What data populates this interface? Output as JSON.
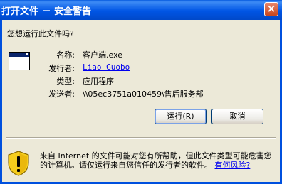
{
  "window": {
    "title": "打开文件 － 安全警告",
    "close_glyph": "×"
  },
  "dialog": {
    "question": "您想运行此文件吗?",
    "fields": [
      {
        "label": "名称:",
        "value": "客户端.exe"
      },
      {
        "label": "发行者:",
        "value": "Liao Guobo"
      },
      {
        "label": "类型:",
        "value": "应用程序"
      },
      {
        "label": "发送者:",
        "value": "\\\\05ec3751a010459\\售后服务部"
      }
    ],
    "buttons": {
      "run": "运行(R)",
      "cancel": "取消"
    }
  },
  "warning": {
    "text": "来自 Internet 的文件可能对您有所帮助，但此文件类型可能危害您的计算机。请仅运行来自您信任的发行者的软件。",
    "link": "有何风险?",
    "icon": "shield-warning-icon"
  }
}
